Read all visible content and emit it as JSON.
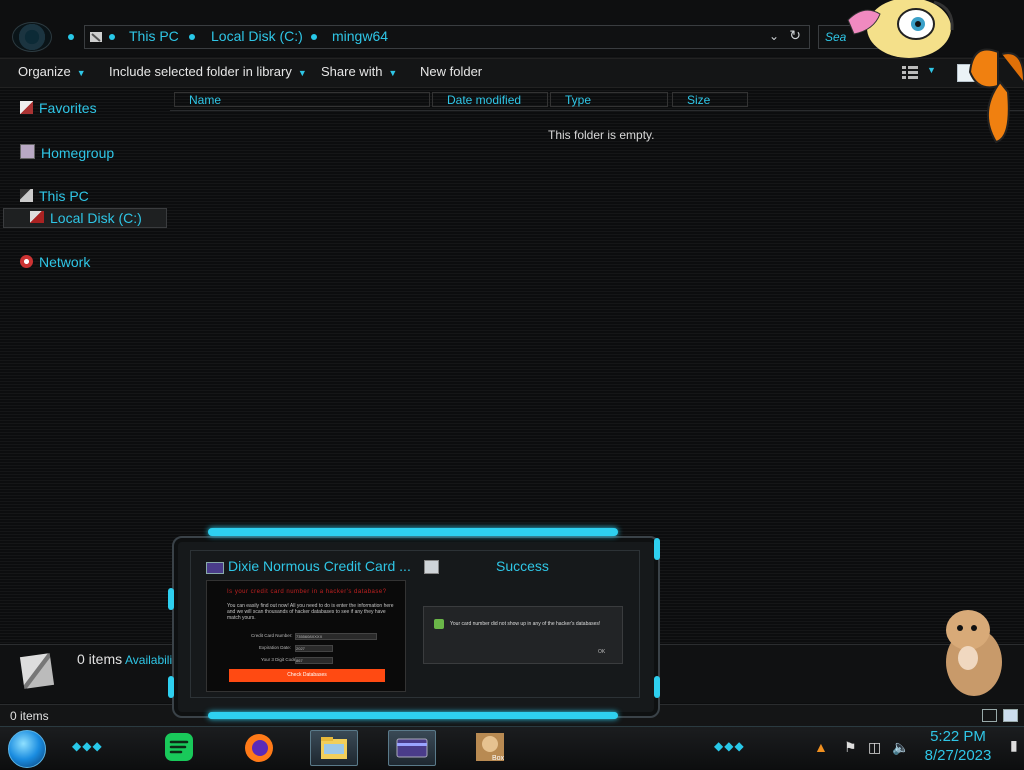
{
  "address_bar": {
    "crumbs": [
      "This PC",
      "Local Disk (C:)",
      "mingw64"
    ],
    "search_placeholder": "Sea"
  },
  "toolbar": {
    "organize": "Organize",
    "include_library": "Include selected folder in library",
    "share_with": "Share with",
    "new_folder": "New folder"
  },
  "nav": {
    "favorites": "Favorites",
    "homegroup": "Homegroup",
    "this_pc": "This PC",
    "local_disk": "Local Disk (C:)",
    "network": "Network"
  },
  "columns": [
    "Name",
    "Date modified",
    "Type",
    "Size"
  ],
  "content": {
    "empty_message": "This folder is empty."
  },
  "details": {
    "count": "0 items",
    "availability": "Availabili"
  },
  "status": {
    "count": "0 items"
  },
  "switcher": {
    "window1_title": "Dixie Normous Credit Card ...",
    "window2_title": "Success",
    "thumb1": {
      "heading": "Is your credit card number in a hacker's database?",
      "text": "You can easily find out now! All you need to do is enter the information here and we will scan thousands of hacker databases to see if any they have match yours.",
      "card_label": "Credit Card Number:",
      "card_value": "7355608XXXX",
      "exp_label": "Expiration Date:",
      "exp_value": "2027",
      "cvv_label": "Your 3 Digit Code:",
      "cvv_value": "867",
      "button": "Check Databases"
    },
    "thumb2": {
      "message": "Your card number did not show up in any of the hacker's databases!",
      "ok": "OK"
    }
  },
  "taskbar": {
    "apps": [
      "start-orb",
      "spotify",
      "firefox",
      "file-explorer",
      "credit-card-app",
      "hamster-box"
    ],
    "time": "5:22 PM",
    "date": "8/27/2023"
  },
  "colors": {
    "accent": "#2fc6e6",
    "glow": "#2ed0f0",
    "button_orange": "#ff4a12"
  }
}
